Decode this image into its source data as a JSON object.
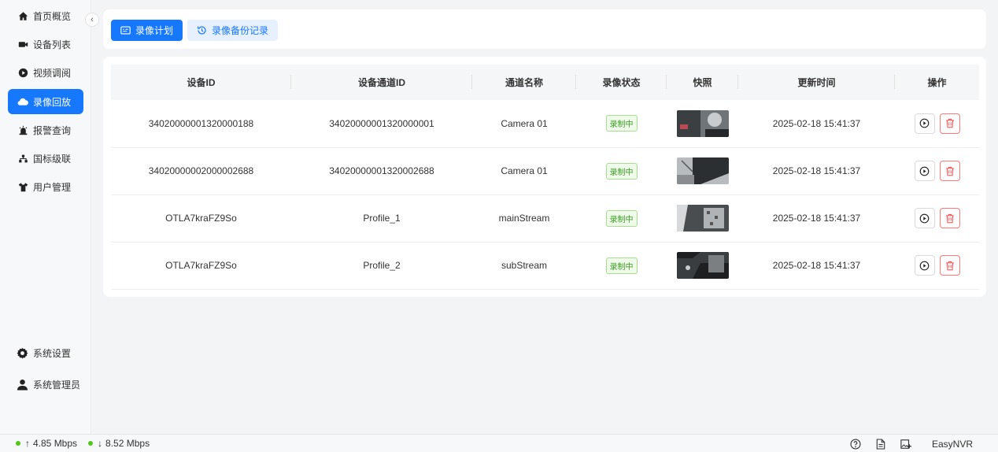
{
  "sidebar": {
    "items": [
      {
        "label": "首页概览",
        "icon": "home-icon"
      },
      {
        "label": "设备列表",
        "icon": "video-camera-icon"
      },
      {
        "label": "视频调阅",
        "icon": "play-circle-icon"
      },
      {
        "label": "录像回放",
        "icon": "cloud-icon",
        "active": true
      },
      {
        "label": "报警查询",
        "icon": "alarm-icon"
      },
      {
        "label": "国标级联",
        "icon": "cascade-icon"
      },
      {
        "label": "用户管理",
        "icon": "user-shirt-icon"
      }
    ],
    "bottom": [
      {
        "label": "系统设置",
        "icon": "gear-icon"
      },
      {
        "label": "系统管理员",
        "icon": "user-icon"
      }
    ]
  },
  "tabs": {
    "plan_label": "录像计划",
    "backup_label": "录像备份记录"
  },
  "table": {
    "headers": [
      "设备ID",
      "设备通道ID",
      "通道名称",
      "录像状态",
      "快照",
      "更新时间",
      "操作"
    ],
    "rows": [
      {
        "device_id": "34020000001320000188",
        "channel_id": "34020000001320000001",
        "channel_name": "Camera 01",
        "status": "录制中",
        "updated": "2025-02-18 15:41:37"
      },
      {
        "device_id": "34020000002000002688",
        "channel_id": "34020000001320002688",
        "channel_name": "Camera 01",
        "status": "录制中",
        "updated": "2025-02-18 15:41:37"
      },
      {
        "device_id": "OTLA7kraFZ9So",
        "channel_id": "Profile_1",
        "channel_name": "mainStream",
        "status": "录制中",
        "updated": "2025-02-18 15:41:37"
      },
      {
        "device_id": "OTLA7kraFZ9So",
        "channel_id": "Profile_2",
        "channel_name": "subStream",
        "status": "录制中",
        "updated": "2025-02-18 15:41:37"
      }
    ]
  },
  "footer": {
    "upload": "4.85 Mbps",
    "download": "8.52 Mbps",
    "brand": "EasyNVR"
  },
  "colors": {
    "primary": "#1677ff",
    "success": "#52c41a",
    "danger": "#ff4d4f"
  }
}
